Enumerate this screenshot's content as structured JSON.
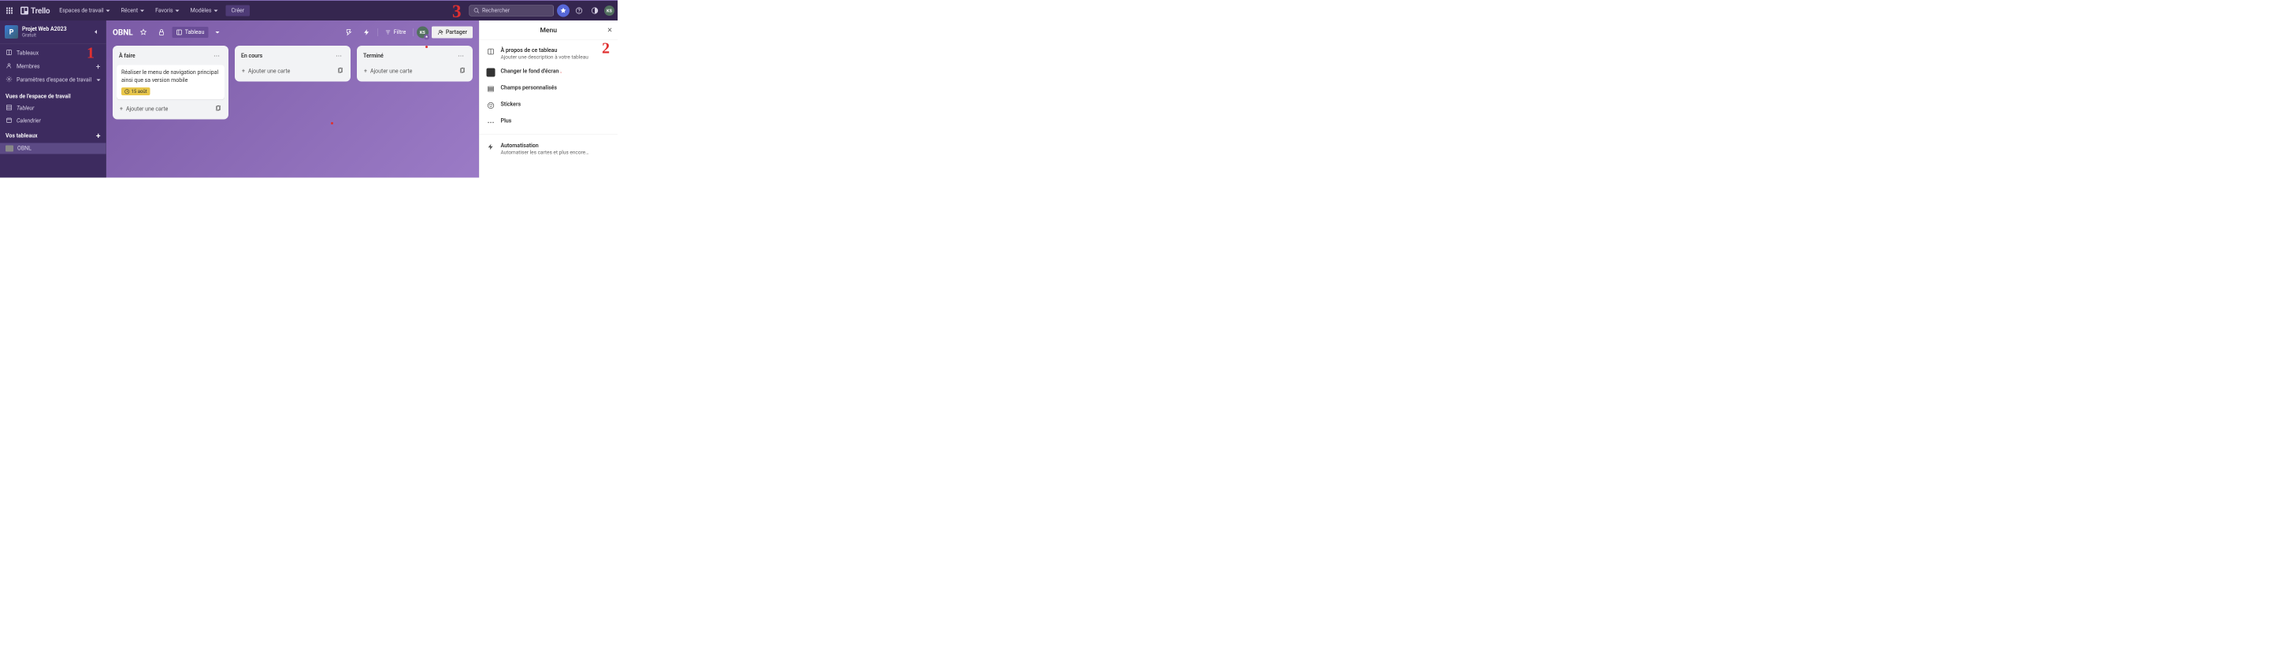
{
  "header": {
    "brand": "Trello",
    "nav": {
      "workspaces": "Espaces de travail",
      "recent": "Récent",
      "starred": "Favoris",
      "templates": "Modèles"
    },
    "create": "Créer",
    "search_placeholder": "Rechercher",
    "avatar_initials": "KS"
  },
  "sidebar": {
    "workspace_initial": "P",
    "workspace_name": "Projet Web A2023",
    "workspace_plan": "Gratuit",
    "nav": {
      "boards": "Tableaux",
      "members": "Membres",
      "settings": "Paramètres d'espace de travail"
    },
    "views_heading": "Vues de l'espace de travail",
    "views": {
      "table": "Tableur",
      "calendar": "Calendrier"
    },
    "your_boards_heading": "Vos tableaux",
    "boards": [
      "OBNL"
    ]
  },
  "board": {
    "title": "OBNL",
    "view_button": "Tableau",
    "filter": "Filtre",
    "share": "Partager",
    "avatar_initials": "KS",
    "lists": [
      {
        "title": "À faire",
        "cards": [
          {
            "text": "Réaliser le menu de navigation principal ainsi que sa version mobile",
            "date": "15 août"
          }
        ],
        "add": "Ajouter une carte"
      },
      {
        "title": "En cours",
        "cards": [],
        "add": "Ajouter une carte"
      },
      {
        "title": "Terminé",
        "cards": [],
        "add": "Ajouter une carte"
      }
    ]
  },
  "menu": {
    "title": "Menu",
    "items": {
      "about_title": "À propos de ce tableau",
      "about_sub": "Ajouter une description à votre tableau",
      "background": "Changer le fond d'écran",
      "custom_fields": "Champs personnalisés",
      "stickers": "Stickers",
      "more": "Plus",
      "automation_title": "Automatisation",
      "automation_sub": "Automatiser les cartes et plus encore…"
    }
  },
  "annotations": {
    "a1": "1",
    "a2": "2",
    "a3": "3"
  }
}
